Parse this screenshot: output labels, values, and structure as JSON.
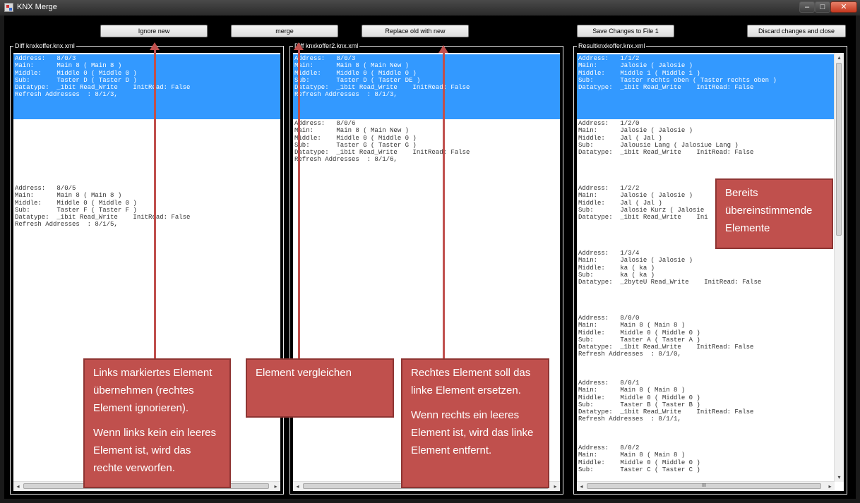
{
  "window": {
    "title": "KNX Merge",
    "minimize_glyph": "‒",
    "maximize_glyph": "□",
    "close_glyph": "✕"
  },
  "toolbar": {
    "ignore_new": "Ignore new",
    "merge": "merge",
    "replace_old_with_new": "Replace old with new",
    "save_changes": "Save Changes to File 1",
    "discard_changes": "Discard changes and close"
  },
  "panels": {
    "left": {
      "title": "Diff knxkoffer.knx.xml",
      "items": [
        {
          "selected": true,
          "text": "Address:   8/0/3\nMain:      Main 8 ( Main 8 )\nMiddle:    Middle 0 ( Middle 0 )\nSub:       Taster D ( Taster D )\nDatatype:  _1bit Read_Write    InitRead: False\nRefresh Addresses  : 8/1/3,"
        },
        {
          "selected": false,
          "text": ""
        },
        {
          "selected": false,
          "text": "Address:   8/0/5\nMain:      Main 8 ( Main 8 )\nMiddle:    Middle 0 ( Middle 0 )\nSub:       Taster F ( Taster F )\nDatatype:  _1bit Read_Write    InitRead: False\nRefresh Addresses  : 8/1/5,"
        }
      ]
    },
    "middle": {
      "title": "Diff knxkoffer2.knx.xml",
      "items": [
        {
          "selected": true,
          "text": "Address:   8/0/3\nMain:      Main 8 ( Main New )\nMiddle:    Middle 0 ( Middle 0 )\nSub:       Taster D ( Taster DE )\nDatatype:  _1bit Read_Write    InitRead: False\nRefresh Addresses  : 8/1/3,"
        },
        {
          "selected": false,
          "text": "Address:   8/0/6\nMain:      Main 8 ( Main New )\nMiddle:    Middle 0 ( Middle 0 )\nSub:       Taster G ( Taster G )\nDatatype:  _1bit Read_Write    InitRead: False\nRefresh Addresses  : 8/1/6,"
        }
      ]
    },
    "right": {
      "title": "Resultknxkoffer.knx.xml",
      "items": [
        {
          "selected": true,
          "text": "Address:   1/1/2\nMain:      Jalosie ( Jalosie )\nMiddle:    Middle 1 ( Middle 1 )\nSub:       Taster rechts oben ( Taster rechts oben )\nDatatype:  _1bit Read_Write    InitRead: False"
        },
        {
          "selected": false,
          "text": "Address:   1/2/0\nMain:      Jalosie ( Jalosie )\nMiddle:    Jal ( Jal )\nSub:       Jalousie Lang ( Jalosiue Lang )\nDatatype:  _1bit Read_Write    InitRead: False"
        },
        {
          "selected": false,
          "text": "Address:   1/2/2\nMain:      Jalosie ( Jalosie )\nMiddle:    Jal ( Jal )\nSub:       Jalosie Kurz ( Jalosie\nDatatype:  _1bit Read_Write    Ini"
        },
        {
          "selected": false,
          "text": "Address:   1/3/4\nMain:      Jalosie ( Jalosie )\nMiddle:    ka ( ka )\nSub:       ka ( ka )\nDatatype:  _2byteU Read_Write    InitRead: False"
        },
        {
          "selected": false,
          "text": "Address:   8/0/0\nMain:      Main 8 ( Main 8 )\nMiddle:    Middle 0 ( Middle 0 )\nSub:       Taster A ( Taster A )\nDatatype:  _1bit Read_Write    InitRead: False\nRefresh Addresses  : 8/1/0,"
        },
        {
          "selected": false,
          "text": "Address:   8/0/1\nMain:      Main 8 ( Main 8 )\nMiddle:    Middle 0 ( Middle 0 )\nSub:       Taster B ( Taster B )\nDatatype:  _1bit Read_Write    InitRead: False\nRefresh Addresses  : 8/1/1,"
        },
        {
          "selected": false,
          "text": "Address:   8/0/2\nMain:      Main 8 ( Main 8 )\nMiddle:    Middle 0 ( Middle 0 )\nSub:       Taster C ( Taster C )"
        }
      ]
    }
  },
  "scroll_glyphs": {
    "left": "◂",
    "right": "▸",
    "up": "▴",
    "down": "▾",
    "grip": "III"
  },
  "annotations": {
    "ignore_note": [
      "Links markiertes Element übernehmen (rechtes Element ignorieren).",
      "Wenn links kein ein leeres Element ist, wird das rechte verworfen."
    ],
    "merge_note": [
      "Element vergleichen"
    ],
    "replace_note": [
      "Rechtes Element soll das linke Element ersetzen.",
      "Wenn rechts ein leeres Element ist, wird das linke Element entfernt."
    ],
    "matching_note": [
      "Bereits übereinstimmende Elemente"
    ]
  }
}
